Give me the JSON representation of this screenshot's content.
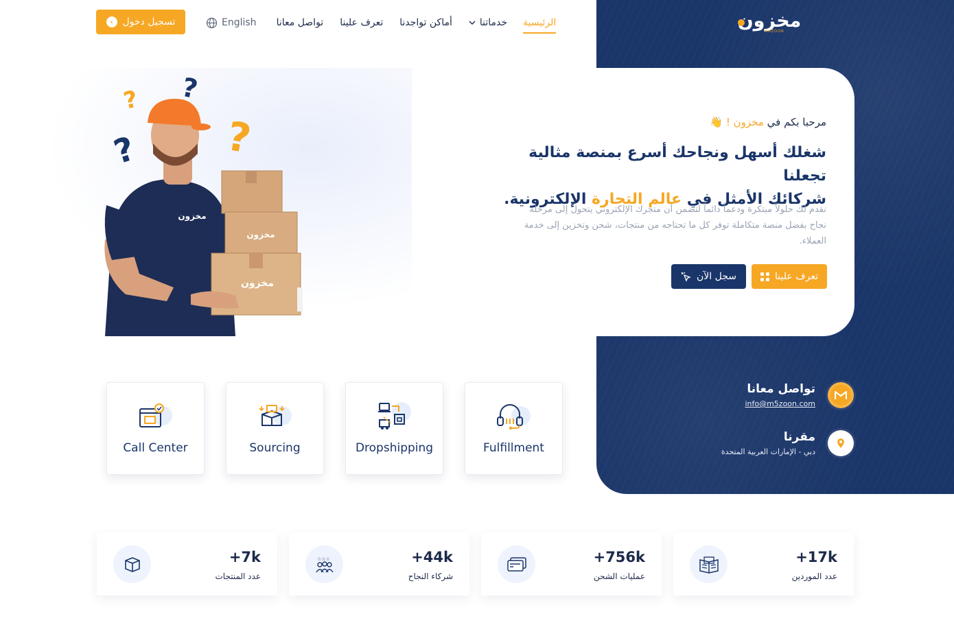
{
  "brand": {
    "logo_text": "مخزون",
    "logo_subtext": "MAZOON",
    "accent_color": "#f6a724",
    "navy_color": "#1a3569"
  },
  "header": {
    "login_label": "تسجيل دخول",
    "language_label": "English",
    "nav": [
      {
        "label": "الرئيسية"
      },
      {
        "label": "خدماتنا"
      },
      {
        "label": "أماكن تواجدنا"
      },
      {
        "label": "تعرف علينا"
      },
      {
        "label": "تواصل معانا"
      }
    ]
  },
  "hero": {
    "welcome_prefix": "مرحبا بكم في",
    "welcome_brand": "مخزون !",
    "welcome_emoji": "👋",
    "headline_1": "شغلك أسهل ونجاحك أسرع بمنصة مثالية تجعلنا",
    "headline_2a": "شركائك الأمثل في",
    "headline_2b": "عالم التجارة",
    "headline_2c": "الإلكترونية.",
    "description": "نقدم لك حلولاً مبتكرة ودعماً دائماً لتضمن أن متجرك الإلكتروني يتحول إلى مرحلة نجاح بفضل منصة متكاملة توفر كل ما تحتاجه من منتجات، شحن وتخزين إلى خدمة العملاء.",
    "about_button": "تعرف علينا",
    "register_button": "سجل الآن"
  },
  "contact": {
    "title": "تواصل معانا",
    "email": "info@m5zoon.com",
    "location_title": "مقرنا",
    "location": "دبي - الإمارات العربية المتحدة"
  },
  "services": [
    {
      "label": "Call Center",
      "icon": "call-center-icon"
    },
    {
      "label": "Sourcing",
      "icon": "sourcing-icon"
    },
    {
      "label": "Dropshipping",
      "icon": "dropshipping-icon"
    },
    {
      "label": "Fulfillment",
      "icon": "fulfillment-icon"
    }
  ],
  "stats": [
    {
      "number": "+7k",
      "label": "عدد المنتجات",
      "icon": "box-icon"
    },
    {
      "number": "+44k",
      "label": "شركاء النجاح",
      "icon": "partners-icon"
    },
    {
      "number": "+756k",
      "label": "عمليات الشحن",
      "icon": "card-icon"
    },
    {
      "number": "+17k",
      "label": "عدد الموردين",
      "icon": "book-icon"
    }
  ]
}
